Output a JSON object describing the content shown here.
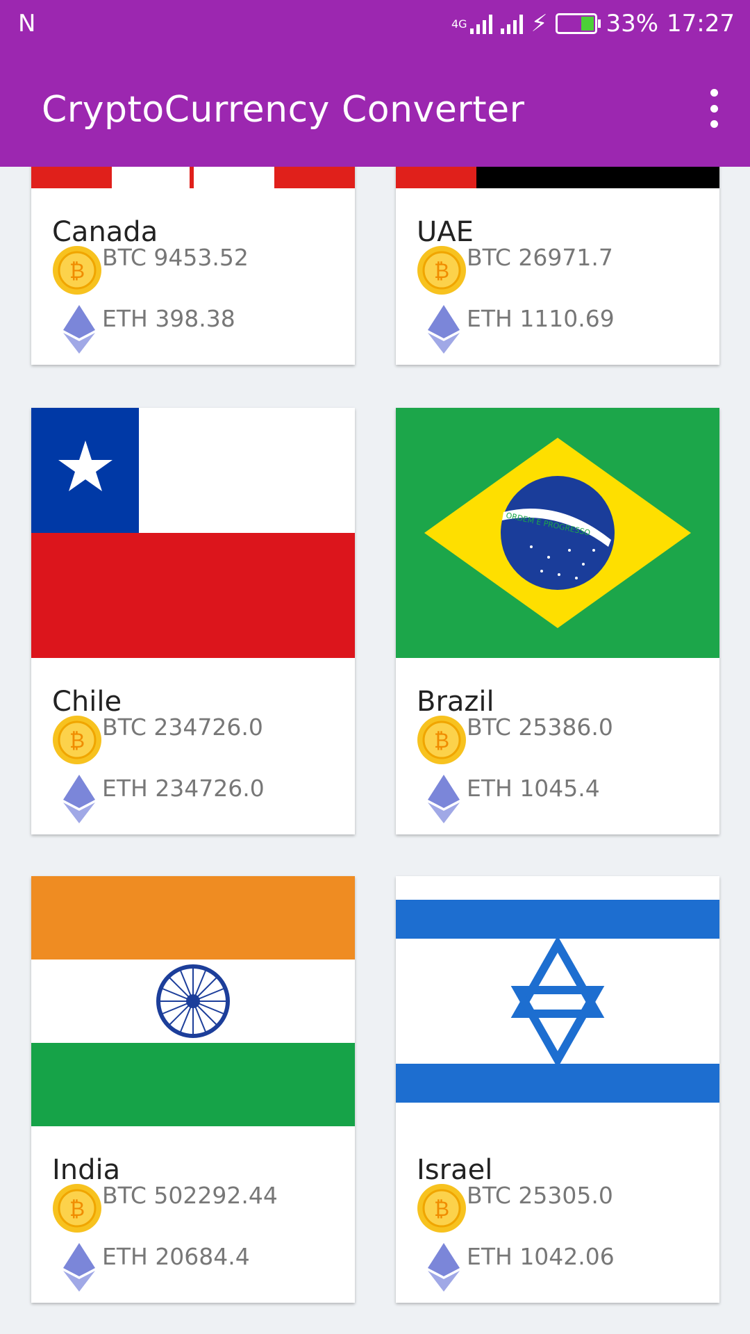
{
  "status_bar": {
    "carrier": "N",
    "network": "4G",
    "battery": "33%",
    "time": "17:27"
  },
  "app": {
    "title": "CryptoCurrency Converter"
  },
  "cards": [
    {
      "country": "Canada",
      "btc": "BTC 9453.52",
      "eth": "ETH 398.38"
    },
    {
      "country": "UAE",
      "btc": "BTC 26971.7",
      "eth": "ETH 1110.69"
    },
    {
      "country": "Chile",
      "btc": "BTC 234726.0",
      "eth": "ETH 234726.0"
    },
    {
      "country": "Brazil",
      "btc": "BTC 25386.0",
      "eth": "ETH 1045.4"
    },
    {
      "country": "India",
      "btc": "BTC 502292.44",
      "eth": "ETH 20684.4"
    },
    {
      "country": "Israel",
      "btc": "BTC 25305.0",
      "eth": "ETH 1042.06"
    }
  ],
  "flags": {
    "brazil_motto": "ORDEM E PROGRESSO"
  },
  "colors": {
    "app_bar": "#9c27b0",
    "bitcoin": "#f7c21f",
    "ethereum": "#7b86d9"
  }
}
